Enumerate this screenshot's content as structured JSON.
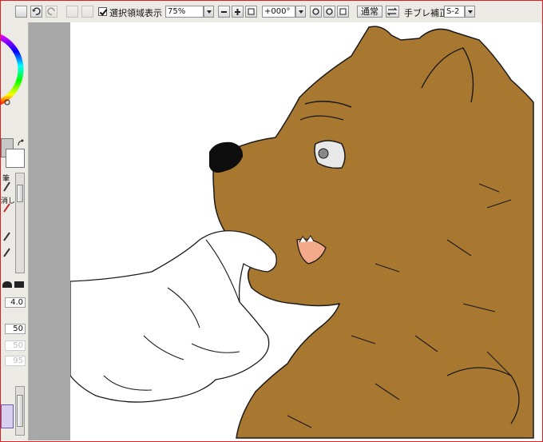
{
  "toolbar": {
    "selection_label": "選択領域表示",
    "zoom_value": "75%",
    "rotation_value": "+000°",
    "blend_mode": "通常",
    "stabilizer_label": "手ブレ補正",
    "stabilizer_value": "S-2"
  },
  "side_panel": {
    "brush_size": "4.0",
    "min_size_pct": "50",
    "opacity_disabled": "50",
    "density_disabled": "95",
    "brush_label_1": "筆",
    "brush_label_2": "消し"
  },
  "colors": {
    "bear_fur": "#a87831",
    "line": "#1a1a1a",
    "canvas_bg": "#ffffff",
    "gutter": "#a8a8a8",
    "mouth": "#f3a98a",
    "frame_border": "#e02020"
  }
}
